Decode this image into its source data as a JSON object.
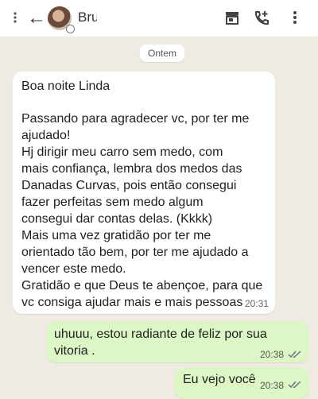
{
  "header": {
    "contact_name": "Bru",
    "icons": [
      "more-vertical-icon",
      "back-arrow-icon",
      "store-icon",
      "call-add-icon",
      "more-vertical-icon"
    ]
  },
  "date_separator": "Ontem",
  "incoming": {
    "lines": [
      "Boa noite Linda",
      "",
      "Passando para agradecer vc, por ter me",
      "ajudado!",
      "Hj dirigir meu carro sem medo, com",
      "mais confiança, lembra dos medos das",
      "Danadas Curvas, pois então consegui",
      "fazer perfeitas sem medo algum",
      "consegui dar contas delas. (Kkkk)",
      "Mais uma vez gratidão por ter me",
      "orientado tão bem, por ter me ajudado a",
      "vencer este medo.",
      "Gratidão e que Deus te abençoe, para que",
      "vc consiga ajudar mais e mais pessoas"
    ],
    "time": "20:31"
  },
  "outgoing": [
    {
      "lines": [
        "uhuuu, estou radiante de feliz por sua",
        "vitoria ."
      ],
      "time": "20:38"
    },
    {
      "lines": [
        "Eu vejo você"
      ],
      "time": "20:38"
    }
  ],
  "colors": {
    "incoming_bg": "#ffffff",
    "outgoing_bg": "#dcf6c5",
    "chat_bg": "#efebe3",
    "read_ticks": "#667781"
  }
}
